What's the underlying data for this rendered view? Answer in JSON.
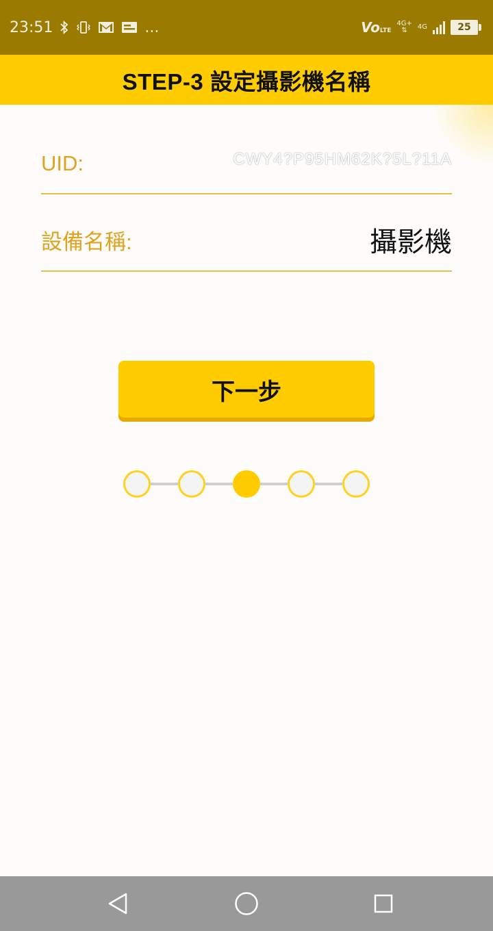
{
  "status_bar": {
    "time": "23:51",
    "more": "...",
    "volte": "Vo",
    "volte_sub": "LTE",
    "net_a": "4G+",
    "net_b": "4G",
    "battery": "25",
    "icons": [
      "bluetooth-icon",
      "vibrate-icon",
      "gmail-icon",
      "message-icon",
      "signal-icon",
      "battery-icon"
    ]
  },
  "header": {
    "title": "STEP-3 設定攝影機名稱"
  },
  "form": {
    "uid_label": "UID:",
    "uid_value": "CWY4?P95HM62K?5L?11A",
    "name_label": "設備名稱:",
    "name_value": "攝影機"
  },
  "next_button": {
    "label": "下一步"
  },
  "stepper": {
    "total": 5,
    "current": 3
  },
  "nav_bar": {
    "icons": [
      "back-icon",
      "home-icon",
      "recents-icon"
    ]
  },
  "colors": {
    "status_bar": "#9a7b00",
    "accent": "#ffcc00",
    "label": "#e0a31f",
    "nav_bar": "#999999"
  }
}
